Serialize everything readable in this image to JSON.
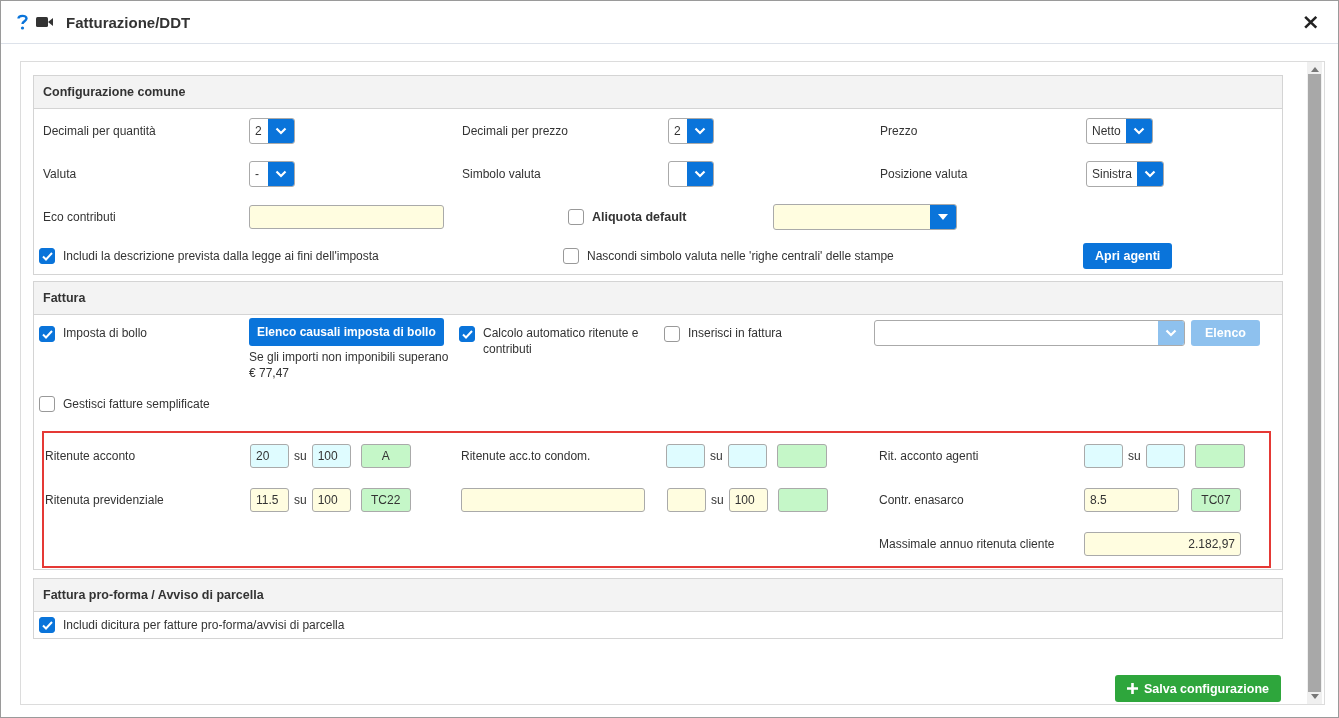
{
  "window": {
    "title": "Fatturazione/DDT",
    "close": "×"
  },
  "common": {
    "title": "Configurazione comune",
    "selects": [
      {
        "label": "Decimali per quantità",
        "value": "2"
      },
      {
        "label": "Decimali per prezzo",
        "value": "2"
      },
      {
        "label": "Prezzo",
        "value": "Netto"
      },
      {
        "label": "Valuta",
        "value": "-"
      },
      {
        "label": "Simbolo valuta"
      },
      {
        "label": "Posizione valuta",
        "value": "Sinistra"
      }
    ],
    "eco": {
      "label": "Eco contributi"
    },
    "aliquota": {
      "label": "Aliquota default",
      "checked": false
    },
    "checks": [
      {
        "label": "Includi la descrizione prevista dalla legge ai fini dell'imposta",
        "checked": true
      },
      {
        "label": "Nascondi simbolo valuta nelle 'righe centrali' delle stampe",
        "checked": false
      }
    ],
    "button": "Apri agenti"
  },
  "invoice": {
    "title": "Fattura",
    "bollo": {
      "label": "Imposta di bollo",
      "checked": true
    },
    "bollo_button": "Elenco causali imposta di bollo",
    "bollo_note": "Se gli importi non imponibili superano € 77,47",
    "auto": {
      "label": "Calcolo automatico ritenute e contributi",
      "checked": true
    },
    "insert": {
      "label": "Inserisci in fattura",
      "checked": false
    },
    "list_button": {
      "label": "Elenco",
      "disabled": true
    },
    "simplified": {
      "label": "Gestisci fatture semplificate",
      "checked": false
    },
    "withholdings": [
      [
        {
          "kind": "ratio",
          "label": "Ritenute acconto",
          "rate": {
            "value": "20",
            "color": "#dffcff"
          },
          "separator": "su",
          "base": {
            "value": "100",
            "color": "#dffcff"
          },
          "code": {
            "value": "A",
            "color": "#c5f7c8"
          }
        },
        {
          "kind": "ratio",
          "label": "Ritenuta previdenziale",
          "rate": {
            "value": "11.5",
            "color": "#fffde0"
          },
          "separator": "su",
          "base": {
            "value": "100",
            "color": "#fffde0"
          },
          "code": {
            "value": "TC22",
            "color": "#c5f7c8"
          }
        }
      ],
      [
        {
          "kind": "ratio",
          "label": "Ritenute acc.to condom.",
          "rate": {
            "color": "#dffcff"
          },
          "separator": "su",
          "base": {
            "color": "#dffcff"
          },
          "code": {
            "color": "#c5f7c8"
          }
        },
        {
          "kind": "ratio",
          "label_field": {
            "color": "#fffde0"
          },
          "rate": {
            "color": "#fffde0"
          },
          "separator": "su",
          "base": {
            "value": "100",
            "color": "#fffde0"
          },
          "code": {
            "color": "#c5f7c8"
          }
        }
      ],
      [
        {
          "kind": "ratio",
          "label": "Rit. acconto agenti",
          "rate": {
            "color": "#dffcff"
          },
          "separator": "su",
          "base": {
            "color": "#dffcff"
          },
          "code": {
            "color": "#c5f7c8"
          }
        },
        {
          "kind": "single",
          "label": "Contr. enasarco",
          "rate": {
            "value": "8.5",
            "color": "#fffde0"
          },
          "code": {
            "value": "TC07",
            "color": "#c5f7c8"
          }
        },
        {
          "kind": "amount",
          "label": "Massimale annuo ritenuta cliente",
          "rate": {
            "value": "2.182,97",
            "color": "#fffde0"
          }
        }
      ]
    ]
  },
  "proforma": {
    "title": "Fattura pro-forma / Avviso di parcella",
    "check": {
      "label": "Includi dicitura per fatture pro-forma/avvisi di parcella",
      "checked": true
    }
  },
  "save_button": "Salva configurazione"
}
